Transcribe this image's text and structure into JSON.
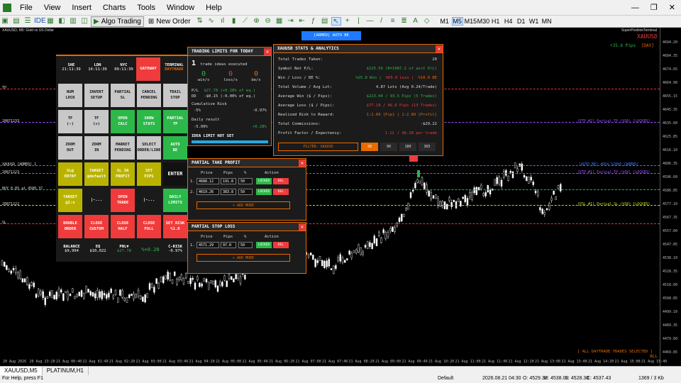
{
  "menu": [
    "File",
    "View",
    "Insert",
    "Charts",
    "Tools",
    "Window",
    "Help"
  ],
  "toolbar": {
    "algo_trading": "Algo Trading",
    "new_order": "New Order",
    "timeframes": [
      "M1",
      "M5",
      "M15",
      "M30",
      "H1",
      "H4",
      "D1",
      "W1",
      "MN"
    ],
    "selected_timeframe": "M5"
  },
  "chart": {
    "symbol_label": "XAUUSD, M5: Gold vs US Dollar",
    "terminal_name": "SuperPositionTerminal",
    "symbol": "XAUUSD",
    "pips_day": "+35.6 Pips",
    "pips_day_suffix": "[DAY]",
    "armed_banner": "[ARMED] AUTO BE",
    "daytrade_note": "[ ALL DAYTRADE TRADES SELECTED ]",
    "all_label": "ALL",
    "left_labels": {
      "tp": "TP",
      "l1": "20871233",
      "l2": "XAUUSD [ARMED] 1",
      "l3": "20871223",
      "buy": "BUY 0.85 at 4580.37",
      "l4": "20871222",
      "sl": "SL"
    },
    "right_labels": {
      "ptp2": "[PTP #2] Partial TP (%50) [LOCKED]",
      "autobe": "[AUTO BE] 4654.52006 [ARMED]",
      "ptp1": "[PTP #1] Partial TP (%50) [LOCKED]",
      "psl1": "[PSL #1] Partial SL (%50) [LOCKED]"
    },
    "time_labels": [
      "20 Aug 2026",
      "20 Aug 23:20",
      "21 Aug 00:40",
      "21 Aug 01:40",
      "21 Aug 02:20",
      "21 Aug 03:00",
      "21 Aug 03:40",
      "21 Aug 04:20",
      "21 Aug 05:00",
      "21 Aug 05:40",
      "21 Aug 06:20",
      "21 Aug 07:00",
      "21 Aug 07:40",
      "21 Aug 08:20",
      "21 Aug 09:00",
      "21 Aug 09:40",
      "21 Aug 10:20",
      "21 Aug 11:00",
      "21 Aug 11:40",
      "21 Aug 12:20",
      "21 Aug 13:00",
      "21 Aug 13:40",
      "21 Aug 14:20",
      "21 Aug 15:00",
      "21 Aug 15:40"
    ],
    "price_labels": [
      "4694.20",
      "4684.35",
      "4674.65",
      "4664.90",
      "4655.15",
      "4645.35",
      "4635.60",
      "4625.85",
      "4616.10",
      "4606.35",
      "4596.60",
      "4586.85",
      "4577.10",
      "4567.35",
      "4557.60",
      "4547.85",
      "4538.10",
      "4528.35",
      "4518.60",
      "4508.85",
      "4499.10",
      "4489.35",
      "4479.60",
      "4469.85"
    ]
  },
  "panel": {
    "clocks": [
      {
        "name": "SHE",
        "time": "21:11:39"
      },
      {
        "name": "LDN",
        "time": "14:11:39"
      },
      {
        "name": "NYC",
        "time": "09:11:39"
      }
    ],
    "gateway": "GATEWAY",
    "terminal": "TERMINAL",
    "daytrade": "DAYTRADE",
    "buttons": [
      "NUM\nLOCK",
      "INVERT\nSETUP",
      "PARTIAL\nSL",
      "CANCEL\nPENDING",
      "TRAIL\nSTOP",
      "TF\n(-)",
      "TF\n(+)",
      "OPEN\nCALC",
      "SHOW\nSTATS",
      "PARTIAL\nTP",
      "ZOOM\nOUT",
      "ZOOM\nIN",
      "MARKET\nPENDING",
      "SELECT\nORDER/LINE",
      "AUTO\nBE",
      "SL@\nENTRY",
      "TARGET\n@default",
      "SL IN\nPROFIT",
      "SET\nPIPS",
      "ENTER",
      "TARGET\n@1:x",
      "|-...",
      "OPEN\nTRADE",
      "|-...",
      "DAILY\nLIMITS",
      "DOUBLE\nORDER",
      "CLOSE\nCUSTOM",
      "CLOSE\nHALF",
      "CLOSE\nFULL",
      "SET RISK\n%1.0"
    ],
    "footer": {
      "balance_label": "BALANCE",
      "balance": "$9,994",
      "eq_label": "EQ",
      "eq": "$10,022",
      "pnl_label": "PNL▼",
      "pnl": "$27.78",
      "pct": "%+0.28",
      "crisk_label": "C-RISK",
      "crisk": "-0.97%"
    }
  },
  "limits": {
    "title": "TRADING LIMITS FOR TODAY",
    "ideas_count": "1",
    "ideas_text": "trade ideas executed",
    "win": "0",
    "win_label": "win/s",
    "loss": "0",
    "loss_label": "loss/s",
    "be": "0",
    "be_label": "be/s",
    "pl_label": "P/L",
    "pl_value": "$27.78 (+0.28% of eq.)",
    "dd_label": "DD",
    "dd_value": "-$0.15 (-0.00% of eq.)",
    "cum_risk_label": "Cumulative Risk",
    "cum_risk_min": "-5%",
    "cum_risk_value": "-0.97%",
    "daily_label": "Daily result",
    "daily_min": "-5.00%",
    "daily_value": "+0.28%",
    "idea_limit": "IDEA LIMIT NOT SET"
  },
  "stats": {
    "title": "XAUUSD STATS & ANALYTICS",
    "rows": [
      {
        "label": "Total Trades Taken:",
        "value": "20"
      },
      {
        "label": "Symbol Net P/L:",
        "value": "$125.59 (R=1987.2 of acct P/L)"
      },
      {
        "label": "Win / Loss / BE %:",
        "win": "%25.0 Win |",
        "loss": "%65.0 Loss |",
        "be": "%10.0 BE"
      },
      {
        "label": "Total Volume / Avg Lot:",
        "value": "4.87 Lots (Avg 0.24/Trade)"
      },
      {
        "label": "Average Win ($ / Pips):",
        "value": "$223.04 / 93.5 Pips (5 Trades)"
      },
      {
        "label": "Average Loss ($ / Pips):",
        "value": "$77.18 / 46.6 Pips (13 Trades)"
      },
      {
        "label": "Realized Risk to Reward:",
        "value": "1:2.89 [Pip] | 1:2.89 [Profit]"
      },
      {
        "label": "Total Commissions:",
        "value": "-$29.22"
      },
      {
        "label": "Profit Factor / Expectency:",
        "pf": "1.11",
        "exp": "/  $6.28 per trade"
      }
    ],
    "filter": "FILTER: XAUUSD",
    "periods": [
      "30",
      "90",
      "180",
      "365"
    ],
    "selected_period": "30"
  },
  "ptp": {
    "title": "PARTIAL TAKE PROFIT",
    "headers": [
      "Price",
      "Pips",
      "%",
      "Action"
    ],
    "rows": [
      {
        "n": "1.",
        "price": "4688.12",
        "pips": "191.8",
        "pct": "50",
        "locked": "LOCKED",
        "del": "DEL"
      },
      {
        "n": "2.",
        "price": "4619.26",
        "pips": "383.8",
        "pct": "50",
        "locked": "LOCKED",
        "del": "DEL"
      }
    ],
    "add_more": "+ ADD MORE"
  },
  "psl": {
    "title": "PARTIAL STOP LOSS",
    "headers": [
      "Price",
      "Pips",
      "%",
      "Action"
    ],
    "rows": [
      {
        "n": "1.",
        "price": "4571.29",
        "pips": "97.0",
        "pct": "50",
        "locked": "LOCKED",
        "del": "DEL"
      }
    ],
    "add_more": "+ ADD MORE"
  },
  "tabs": [
    "XAUUSD,M5",
    "PLATINUM,H1"
  ],
  "status": {
    "help": "For Help, press F1",
    "profile": "Default",
    "time": "2026.08.21 04:30",
    "o": "O: 4529.32",
    "h": "H: 4538.08",
    "l": "L: 4528.38",
    "c": "C: 4537.43",
    "traffic": "1369 / 3 Kb"
  },
  "colors": {
    "accent": "#e86a00",
    "green": "#2db84a",
    "red": "#ef3b3b",
    "purple": "#9b4dff",
    "blue": "#3a7bff"
  }
}
